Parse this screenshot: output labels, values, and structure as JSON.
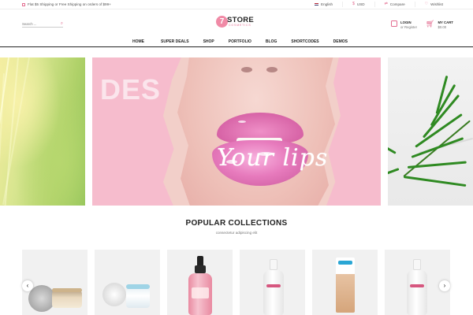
{
  "topbar": {
    "promo": "Flat $5 Shipping or Free Shipping on orders of $99+",
    "language": "English",
    "currency": "USD",
    "compare": "Compare",
    "wishlist": "Wishlist"
  },
  "header": {
    "search_placeholder": "Search ...",
    "logo_number": "7",
    "logo_name": "STORE",
    "logo_tagline": "COSMETICS",
    "login": "LOGIN",
    "register": "or Register",
    "cart_label": "MY CART",
    "cart_total": "$0.00"
  },
  "nav": {
    "items": [
      "HOME",
      "SUPER DEALS",
      "SHOP",
      "PORTFOLIO",
      "BLOG",
      "SHORTCODES",
      "DEMOS"
    ]
  },
  "banner": {
    "overlay_text": "DES",
    "script_text": "Your lips"
  },
  "collections": {
    "title": "POPULAR COLLECTIONS",
    "subtitle": "consectetur adipiscing elit",
    "prev_arrow": "‹",
    "next_arrow": "›"
  },
  "colors": {
    "accent": "#e36b8f",
    "banner_pink": "#f6bccd",
    "lip_pink": "#e77bbd",
    "nav_border": "#222222"
  },
  "icons": [
    "gift-icon",
    "flag-icon",
    "dollar-icon",
    "compare-icon",
    "heart-icon",
    "search-icon",
    "bag-icon",
    "cart-icon",
    "chevron-left-icon",
    "chevron-right-icon"
  ]
}
